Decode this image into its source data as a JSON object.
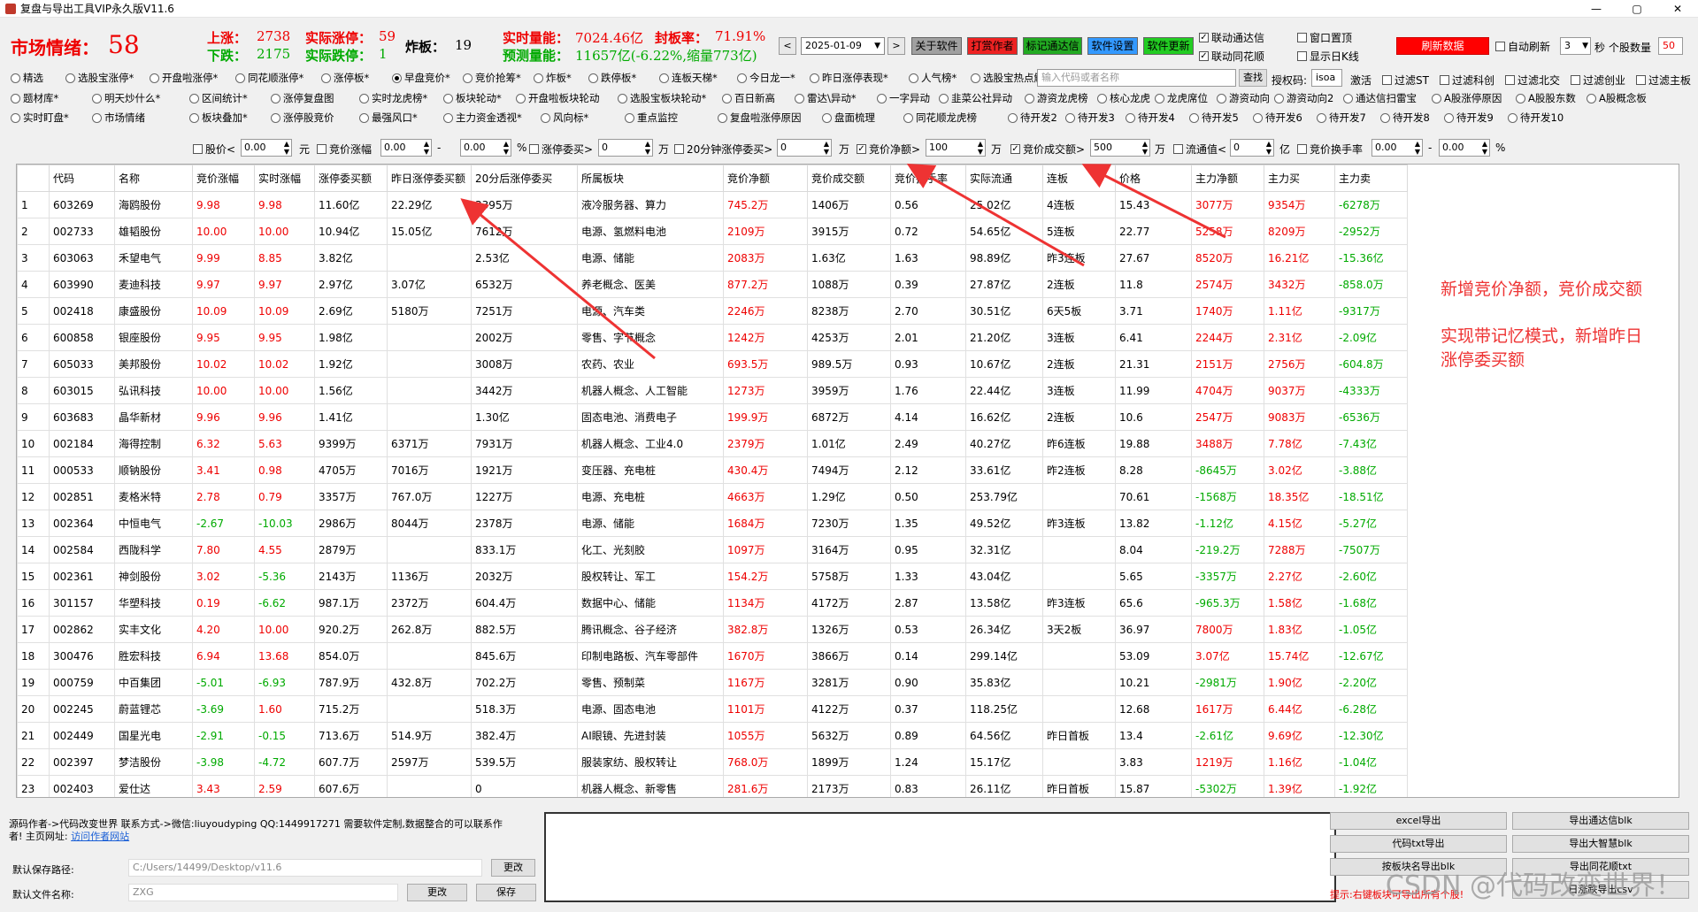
{
  "window": {
    "title": "复盘与导出工具VIP永久版V11.6",
    "minimize": "—",
    "maximize": "▢",
    "close": "✕"
  },
  "market": {
    "label": "市场情绪：",
    "value": "58"
  },
  "stats": {
    "up_label": "上涨：",
    "up": "2738",
    "actual_up_label": "实际涨停：",
    "actual_up": "59",
    "bomb_label": "炸板：",
    "bomb": "19",
    "realtime_label": "实时量能：",
    "realtime": "7024.46亿",
    "seal_label": "封板率：",
    "seal": "71.91%",
    "down_label": "下跌：",
    "down": "2175",
    "actual_down_label": "实际跌停：",
    "actual_down": "1",
    "forecast_label": "预测量能：",
    "forecast": "11657亿(-6.22%,缩量773亿)"
  },
  "toolbar": {
    "prev": "<",
    "date": "2025-01-09",
    "date_arrow": "▼",
    "next": ">",
    "about": "关于软件",
    "reward": "打赏作者",
    "mark_tdx": "标记通达信",
    "settings": "软件设置",
    "update": "软件更新",
    "link_tdx": "联动通达信",
    "link_ths": "联动同花顺",
    "win_top": "窗口置顶",
    "show_day": "显示日K线",
    "refresh": "刷新数据",
    "auto_refresh": "自动刷新",
    "interval": "3",
    "interval_arrow": "▼",
    "sec": "秒",
    "count_label": "个股数量",
    "count": "50"
  },
  "options_row1": [
    "精选",
    "选股宝涨停*",
    "开盘啦涨停*",
    "同花顺涨停*",
    "涨停板*",
    "早盘竞价*",
    "竞价抢筹*",
    "炸板*",
    "跌停板*",
    "连板天梯*",
    "今日龙一*",
    "昨日涨停表现*",
    "人气榜*",
    "选股宝热点解读*"
  ],
  "options_row1_selected": "早盘竞价*",
  "search": {
    "placeholder": "输入代码或者名称",
    "btn": "查找",
    "auth_label": "授权码:",
    "auth": "isoa",
    "activate": "激活"
  },
  "filters_right": [
    "过滤ST",
    "过滤科创",
    "过滤北交",
    "过滤创业",
    "过滤主板"
  ],
  "options_row2": [
    "题材库*",
    "明天炒什么*",
    "区间统计*",
    "涨停复盘图",
    "实时龙虎榜*",
    "板块轮动*",
    "开盘啦板块轮动",
    "选股宝板块轮动*",
    "百日新高",
    "雷达\\异动*",
    "一字异动",
    "韭菜公社异动",
    "游资龙虎榜",
    "核心龙虎",
    "龙虎席位",
    "游资动向",
    "游资动向2",
    "通达信扫雷宝",
    "A股涨停原因",
    "A股股东数",
    "A股概念板"
  ],
  "options_row3": [
    "实时盯盘*",
    "市场情绪",
    "板块叠加*",
    "涨停股竞价",
    "最强风口*",
    "主力资金透视*",
    "风向标*",
    "重点监控",
    "复盘啦涨停原因",
    "盘面梳理",
    "同花顺龙虎榜",
    "待开发2",
    "待开发3",
    "待开发4",
    "待开发5",
    "待开发6",
    "待开发7",
    "待开发8",
    "待开发9",
    "待开发10"
  ],
  "filterbar": {
    "price": "股价<",
    "price_v": "0.00",
    "yuan": "元",
    "auction_chg": "竞价涨幅",
    "auction_chg_v": "0.00",
    "dash": "-",
    "auction_chg_v2": "0.00",
    "pct": "%",
    "limit_order": "涨停委买>",
    "limit_order_v": "0",
    "wan": "万",
    "limit20": "20分钟涨停委买>",
    "limit20_v": "0",
    "wan2": "万",
    "net": "竞价净额>",
    "net_v": "100",
    "wan3": "万",
    "deal": "竞价成交额>",
    "deal_v": "500",
    "wan4": "万",
    "float": "流通值<",
    "float_v": "0",
    "yi": "亿",
    "turn": "竞价换手率",
    "turn_v": "0.00",
    "dash2": "-",
    "turn_v2": "0.00",
    "pct2": "%"
  },
  "columns": [
    "",
    "代码",
    "名称",
    "竞价涨幅",
    "实时涨幅",
    "涨停委买额",
    "昨日涨停委买额",
    "20分后涨停委买",
    "所属板块",
    "竞价净额",
    "竞价成交额",
    "竞价换手率",
    "实际流通",
    "连板",
    "价格",
    "主力净额",
    "主力买",
    "主力卖"
  ],
  "rows": [
    [
      "1",
      "603269",
      "海鸥股份",
      "9.98",
      "9.98",
      "11.60亿",
      "22.29亿",
      "3395万",
      "液冷服务器、算力",
      "745.2万",
      "1406万",
      "0.56",
      "25.02亿",
      "4连板",
      "15.43",
      "3077万",
      "9354万",
      "-6278万"
    ],
    [
      "2",
      "002733",
      "雄韬股份",
      "10.00",
      "10.00",
      "10.94亿",
      "15.05亿",
      "7612万",
      "电源、氢燃料电池",
      "2109万",
      "3915万",
      "0.72",
      "54.65亿",
      "5连板",
      "22.77",
      "5258万",
      "8209万",
      "-2952万"
    ],
    [
      "3",
      "603063",
      "禾望电气",
      "9.99",
      "8.85",
      "3.82亿",
      "",
      "2.53亿",
      "电源、储能",
      "2083万",
      "1.63亿",
      "1.63",
      "98.89亿",
      "昨3连板",
      "27.67",
      "8520万",
      "16.21亿",
      "-15.36亿"
    ],
    [
      "4",
      "603990",
      "麦迪科技",
      "9.97",
      "9.97",
      "2.97亿",
      "3.07亿",
      "6532万",
      "养老概念、医美",
      "877.2万",
      "1088万",
      "0.39",
      "27.87亿",
      "2连板",
      "11.8",
      "2574万",
      "3432万",
      "-858.0万"
    ],
    [
      "5",
      "002418",
      "康盛股份",
      "10.09",
      "10.09",
      "2.69亿",
      "5180万",
      "7251万",
      "电源、汽车类",
      "2246万",
      "8238万",
      "2.70",
      "30.51亿",
      "6天5板",
      "3.71",
      "1740万",
      "1.11亿",
      "-9317万"
    ],
    [
      "6",
      "600858",
      "银座股份",
      "9.95",
      "9.95",
      "1.98亿",
      "",
      "2002万",
      "零售、字节概念",
      "1242万",
      "4253万",
      "2.01",
      "21.20亿",
      "3连板",
      "6.41",
      "2244万",
      "2.31亿",
      "-2.09亿"
    ],
    [
      "7",
      "605033",
      "美邦股份",
      "10.02",
      "10.02",
      "1.92亿",
      "",
      "3008万",
      "农药、农业",
      "693.5万",
      "989.5万",
      "0.93",
      "10.67亿",
      "2连板",
      "21.31",
      "2151万",
      "2756万",
      "-604.8万"
    ],
    [
      "8",
      "603015",
      "弘讯科技",
      "10.00",
      "10.00",
      "1.56亿",
      "",
      "3442万",
      "机器人概念、人工智能",
      "1273万",
      "3959万",
      "1.76",
      "22.44亿",
      "3连板",
      "11.99",
      "4704万",
      "9037万",
      "-4333万"
    ],
    [
      "9",
      "603683",
      "晶华新材",
      "9.96",
      "9.96",
      "1.41亿",
      "",
      "1.30亿",
      "固态电池、消费电子",
      "199.9万",
      "6872万",
      "4.14",
      "16.62亿",
      "2连板",
      "10.6",
      "2547万",
      "9083万",
      "-6536万"
    ],
    [
      "10",
      "002184",
      "海得控制",
      "6.32",
      "5.63",
      "9399万",
      "6371万",
      "7931万",
      "机器人概念、工业4.0",
      "2379万",
      "1.01亿",
      "2.49",
      "40.27亿",
      "昨6连板",
      "19.88",
      "3488万",
      "7.78亿",
      "-7.43亿"
    ],
    [
      "11",
      "000533",
      "顺钠股份",
      "3.41",
      "0.98",
      "4705万",
      "7016万",
      "1921万",
      "变压器、充电桩",
      "430.4万",
      "7494万",
      "2.12",
      "33.61亿",
      "昨2连板",
      "8.28",
      "-8645万",
      "3.02亿",
      "-3.88亿"
    ],
    [
      "12",
      "002851",
      "麦格米特",
      "2.78",
      "0.79",
      "3357万",
      "767.0万",
      "1227万",
      "电源、充电桩",
      "4663万",
      "1.29亿",
      "0.50",
      "253.79亿",
      "",
      "70.61",
      "-1568万",
      "18.35亿",
      "-18.51亿"
    ],
    [
      "13",
      "002364",
      "中恒电气",
      "-2.67",
      "-10.03",
      "2986万",
      "8044万",
      "2378万",
      "电源、储能",
      "1684万",
      "7230万",
      "1.35",
      "49.52亿",
      "昨3连板",
      "13.82",
      "-1.12亿",
      "4.15亿",
      "-5.27亿"
    ],
    [
      "14",
      "002584",
      "西陇科学",
      "7.80",
      "4.55",
      "2879万",
      "",
      "833.1万",
      "化工、光刻胶",
      "1097万",
      "3164万",
      "0.95",
      "32.31亿",
      "",
      "8.04",
      "-219.2万",
      "7288万",
      "-7507万"
    ],
    [
      "15",
      "002361",
      "神剑股份",
      "3.02",
      "-5.36",
      "2143万",
      "1136万",
      "2032万",
      "股权转让、军工",
      "154.2万",
      "5758万",
      "1.33",
      "43.04亿",
      "",
      "5.65",
      "-3357万",
      "2.27亿",
      "-2.60亿"
    ],
    [
      "16",
      "301157",
      "华塑科技",
      "0.19",
      "-6.62",
      "987.1万",
      "2372万",
      "604.4万",
      "数据中心、储能",
      "1134万",
      "4172万",
      "2.87",
      "13.58亿",
      "昨3连板",
      "65.6",
      "-965.3万",
      "1.58亿",
      "-1.68亿"
    ],
    [
      "17",
      "002862",
      "实丰文化",
      "4.20",
      "10.00",
      "920.2万",
      "262.8万",
      "882.5万",
      "腾讯概念、谷子经济",
      "382.8万",
      "1326万",
      "0.53",
      "26.34亿",
      "3天2板",
      "36.97",
      "7800万",
      "1.83亿",
      "-1.05亿"
    ],
    [
      "18",
      "300476",
      "胜宏科技",
      "6.94",
      "13.68",
      "854.0万",
      "",
      "845.6万",
      "印制电路板、汽车零部件",
      "1670万",
      "3866万",
      "0.14",
      "299.14亿",
      "",
      "53.09",
      "3.07亿",
      "15.74亿",
      "-12.67亿"
    ],
    [
      "19",
      "000759",
      "中百集团",
      "-5.01",
      "-6.93",
      "787.9万",
      "432.8万",
      "702.2万",
      "零售、预制菜",
      "1167万",
      "3281万",
      "0.90",
      "35.83亿",
      "",
      "10.21",
      "-2981万",
      "1.90亿",
      "-2.20亿"
    ],
    [
      "20",
      "002245",
      "蔚蓝锂芯",
      "-3.69",
      "1.60",
      "715.2万",
      "",
      "518.3万",
      "电源、固态电池",
      "1101万",
      "4122万",
      "0.37",
      "118.25亿",
      "",
      "12.68",
      "1617万",
      "6.44亿",
      "-6.28亿"
    ],
    [
      "21",
      "002449",
      "国星光电",
      "-2.91",
      "-0.15",
      "713.6万",
      "514.9万",
      "382.4万",
      "AI眼镜、先进封装",
      "1055万",
      "5632万",
      "0.89",
      "64.56亿",
      "昨日首板",
      "13.4",
      "-2.61亿",
      "9.69亿",
      "-12.30亿"
    ],
    [
      "22",
      "002397",
      "梦洁股份",
      "-3.98",
      "-4.72",
      "607.7万",
      "2597万",
      "539.5万",
      "服装家纺、股权转让",
      "768.0万",
      "1899万",
      "1.24",
      "15.17亿",
      "",
      "3.83",
      "1219万",
      "1.16亿",
      "-1.04亿"
    ],
    [
      "23",
      "002403",
      "爱仕达",
      "3.43",
      "2.59",
      "607.6万",
      "",
      "0",
      "机器人概念、新零售",
      "281.6万",
      "2173万",
      "0.83",
      "26.11亿",
      "昨日首板",
      "15.87",
      "-5302万",
      "1.39亿",
      "-1.92亿"
    ]
  ],
  "notes": {
    "line1": "新增竞价净额，竞价成交额",
    "line2": "实现带记忆模式，新增昨日",
    "line3": "涨停委买额"
  },
  "footer": {
    "author": "源码作者->代码改变世界 联系方式->微信:liuyoudyping QQ:1449917271 需要软件定制,数据整合的可以联系作",
    "author2": "者! 主页网址:",
    "link": "访问作者网站",
    "save_path_label": "默认保存路径:",
    "save_path": "C:/Users/14499/Desktop/v11.6",
    "change": "更改",
    "file_label": "默认文件名称:",
    "file_name": "ZXG",
    "change2": "更改",
    "save": "保存"
  },
  "exports": [
    "excel导出",
    "导出通达信blk",
    "代码txt导出",
    "导出大智慧blk",
    "按板块名导出blk",
    "导出同花顺txt",
    "日涨跌导出csv"
  ],
  "tip": "提示:右键板块可导出所有个股!",
  "watermark": "CSDN @代码改变世界！",
  "colors": {
    "up": "#e00000",
    "down": "#00a000",
    "accent": "#ff0000"
  }
}
